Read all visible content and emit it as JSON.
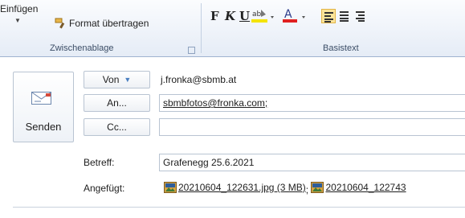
{
  "ribbon": {
    "clipboard": {
      "paste_label": "Einfügen",
      "format_painter_label": "Format übertragen",
      "group_label": "Zwischenablage"
    },
    "basic_text": {
      "bold": "F",
      "italic": "K",
      "underline": "U",
      "group_label": "Basistext"
    }
  },
  "compose": {
    "send_label": "Senden",
    "from_button": "Von",
    "from_value": "j.fronka@sbmb.at",
    "to_button": "An...",
    "to_value": "sbmbfotos@fronka.com;",
    "cc_button": "Cc...",
    "cc_value": "",
    "subject_label": "Betreff:",
    "subject_value": "Grafenegg 25.6.2021",
    "attached_label": "Angefügt:",
    "attachments": [
      {
        "name": "20210604_122631.jpg (3 MB)"
      },
      {
        "name": "20210604_122743"
      }
    ]
  },
  "colors": {
    "ribbon_bg": "#e5ecf6",
    "highlight_yellow": "#f4e400",
    "font_red": "#e02020",
    "active_align": "#fbe49a"
  },
  "icons": [
    "paste-icon",
    "format-painter-icon",
    "highlight-icon",
    "font-color-icon",
    "align-left-icon",
    "align-center-icon",
    "align-right-icon",
    "send-envelope-icon",
    "jpg-file-icon"
  ]
}
